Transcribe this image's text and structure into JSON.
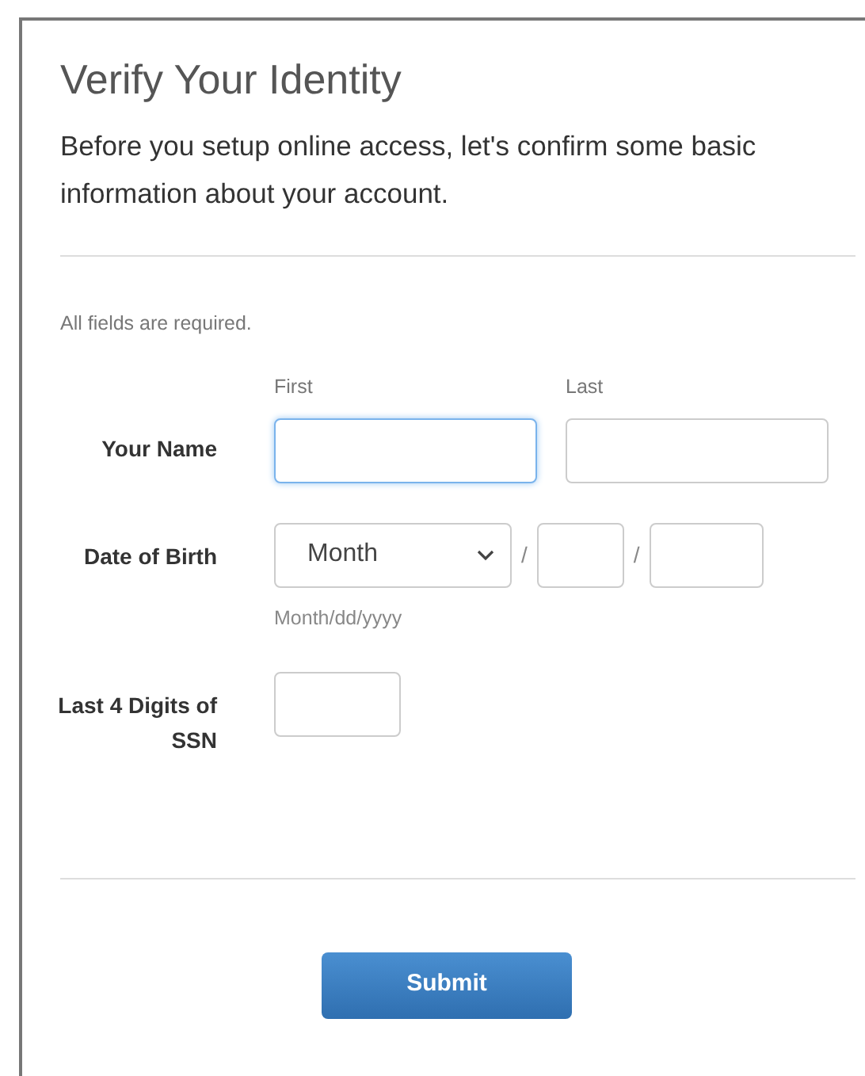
{
  "title": "Verify Your Identity",
  "intro": "Before you setup online access, let's confirm some basic information about your account.",
  "required_note": "All fields are required.",
  "rows": [
    {
      "kind": "name",
      "label": "Your Name",
      "parts": [
        {
          "caption": "First",
          "focused": true
        },
        {
          "caption": "Last",
          "focused": false
        }
      ]
    },
    {
      "kind": "date",
      "label": "Date of Birth",
      "month": "Month",
      "separators": [
        "/",
        "/"
      ],
      "hint": "Month/dd/yyyy"
    },
    {
      "kind": "ssn",
      "label": "Last 4 Digits of SSN"
    }
  ],
  "submit": "Submit"
}
